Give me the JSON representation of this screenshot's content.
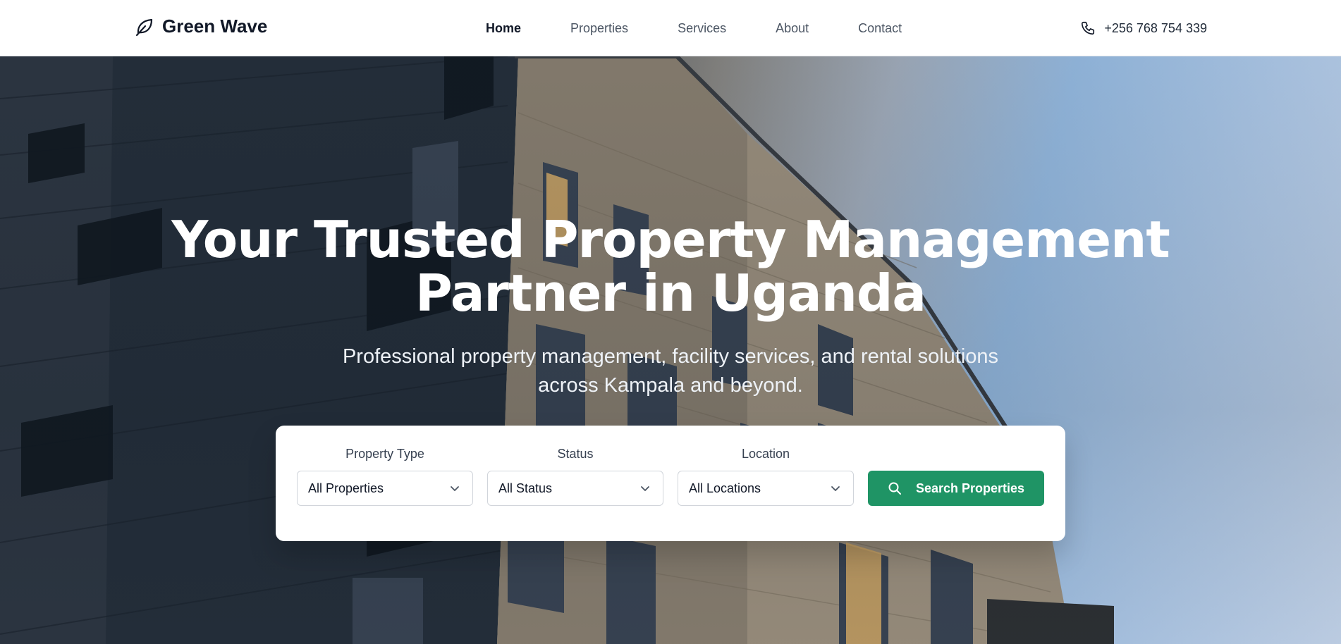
{
  "brand": {
    "name": "Green Wave",
    "icon": "leaf-icon"
  },
  "nav": {
    "links": [
      {
        "label": "Home",
        "active": true
      },
      {
        "label": "Properties",
        "active": false
      },
      {
        "label": "Services",
        "active": false
      },
      {
        "label": "About",
        "active": false
      },
      {
        "label": "Contact",
        "active": false
      }
    ],
    "phone": {
      "icon": "phone-icon",
      "number": "+256 768 754 339"
    }
  },
  "hero": {
    "title_line1": "Your Trusted Property Management",
    "title_line2": "Partner in Uganda",
    "subtitle": "Professional property management, facility services, and rental solutions across Kampala and beyond."
  },
  "search": {
    "fields": [
      {
        "label": "Property Type",
        "value": "All Properties"
      },
      {
        "label": "Status",
        "value": "All Status"
      },
      {
        "label": "Location",
        "value": "All Locations"
      }
    ],
    "button_label": "Search Properties",
    "button_icon": "search-icon"
  },
  "colors": {
    "accent": "#1f9465",
    "nav_active": "#111827",
    "nav_inactive": "#4b5563"
  }
}
